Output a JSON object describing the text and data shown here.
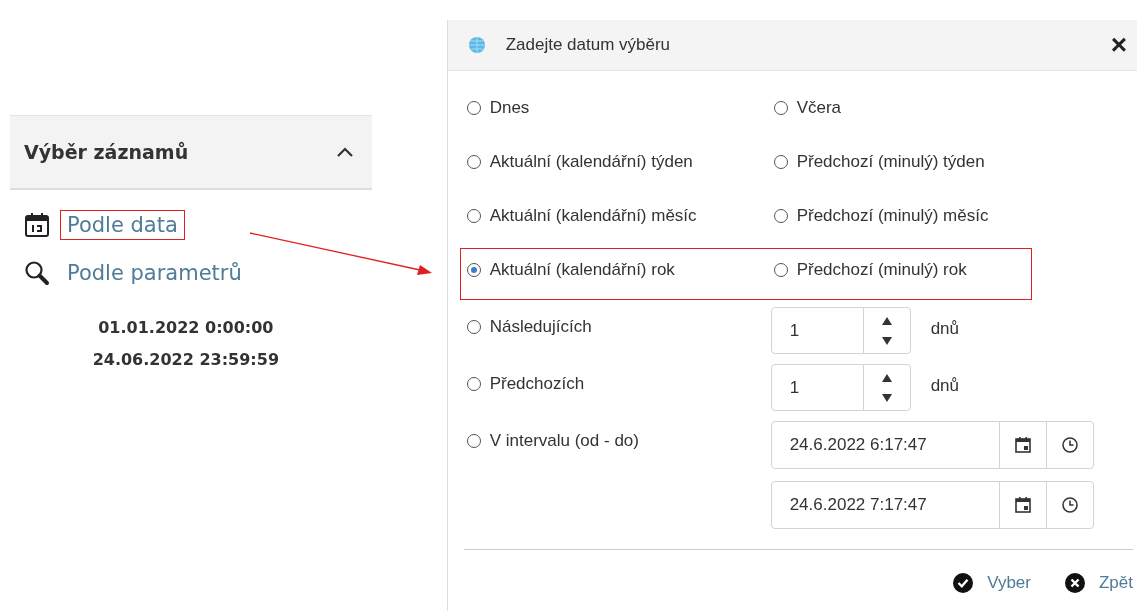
{
  "sidebar": {
    "title": "Výběr záznamů",
    "expanded": true,
    "links": [
      {
        "kind": "calendar",
        "label": "Podle data",
        "highlighted": true
      },
      {
        "kind": "search",
        "label": "Podle parametrů",
        "highlighted": false
      }
    ],
    "range": [
      "01.01.2022 0:00:00",
      "24.06.2022 23:59:59"
    ]
  },
  "dialog": {
    "title": "Zadejte datum výběru",
    "close": "×",
    "options": [
      {
        "label": "Dnes",
        "selected": false
      },
      {
        "label": "Včera",
        "selected": false
      },
      {
        "label": "Aktuální (kalendářní) týden",
        "selected": false
      },
      {
        "label": "Předchozí (minulý) týden",
        "selected": false
      },
      {
        "label": "Aktuální (kalendářní) měsíc",
        "selected": false
      },
      {
        "label": "Předchozí (minulý) měsíc",
        "selected": false
      },
      {
        "label": "Aktuální (kalendářní) rok",
        "selected": true
      },
      {
        "label": "Předchozí (minulý) rok",
        "selected": false
      }
    ],
    "counts": [
      {
        "label": "Následujících",
        "value": "1",
        "unit": "dnů",
        "selected": false
      },
      {
        "label": "Předchozích",
        "value": "1",
        "unit": "dnů",
        "selected": false
      }
    ],
    "interval": {
      "label": "V intervalu (od - do)",
      "selected": false,
      "from": "24.6.2022 6:17:47",
      "to": "24.6.2022 7:17:47"
    },
    "buttons": [
      {
        "kind": "ok",
        "label": "Vyber"
      },
      {
        "kind": "back",
        "label": "Zpět"
      }
    ]
  }
}
